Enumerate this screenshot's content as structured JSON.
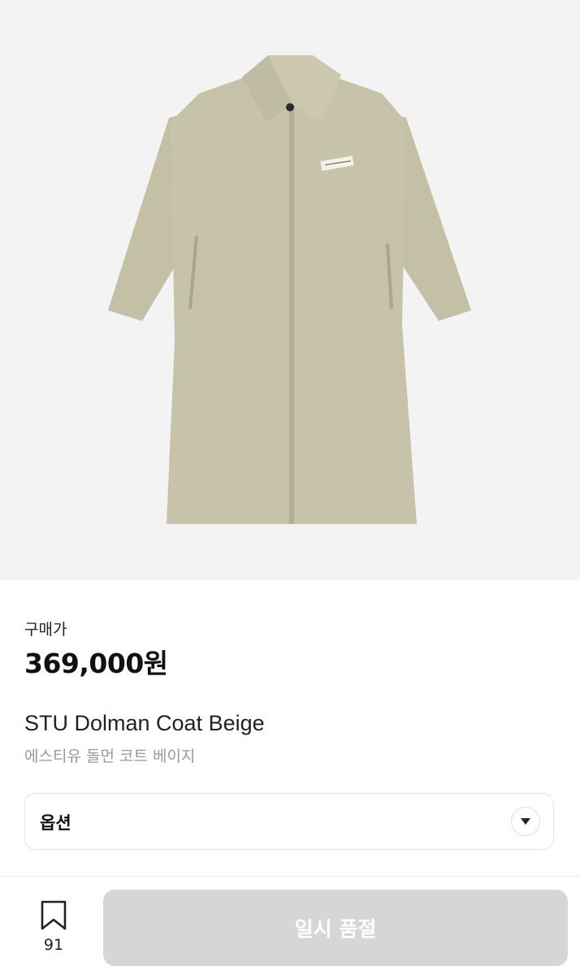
{
  "product": {
    "image_icon": "beige-long-coat-image",
    "price_label": "구매가",
    "price": "369,000원",
    "name_en": "STU Dolman Coat Beige",
    "name_ko": "에스티유 돌먼 코트 베이지"
  },
  "option": {
    "label": "옵션",
    "toggle_icon": "chevron-down-icon"
  },
  "footer": {
    "wish_icon": "bookmark-icon",
    "wish_count": "91",
    "buy_label": "일시 품절",
    "buy_disabled_color": "#d6d6d6"
  },
  "colors": {
    "coat": "#c3c0a6",
    "coat_shadow": "#b0ad93",
    "background": "#f3f3f4"
  }
}
